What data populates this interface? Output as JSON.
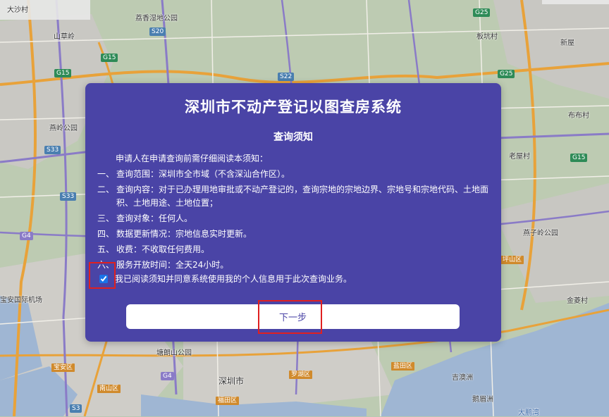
{
  "map": {
    "places": [
      {
        "id": "dashacun",
        "label": "大沙村"
      },
      {
        "id": "lizhuwetland",
        "label": "荔香湿地公园"
      },
      {
        "id": "shancaocun",
        "label": "山草岭"
      },
      {
        "id": "bantiancun",
        "label": "板坑村"
      },
      {
        "id": "xinwu",
        "label": "新屋"
      },
      {
        "id": "yanlingpark",
        "label": "燕岭公园"
      },
      {
        "id": "bubucun",
        "label": "布布村"
      },
      {
        "id": "laolaowu",
        "label": "老屋村"
      },
      {
        "id": "yanzilingpark",
        "label": "燕子岭公园"
      },
      {
        "id": "baoan_airport",
        "label": "宝安国际机场"
      },
      {
        "id": "jinlingcun",
        "label": "金菱村"
      },
      {
        "id": "tanglangshan",
        "label": "塘朗山公园"
      },
      {
        "id": "shenzhenshi",
        "label": "深圳市"
      },
      {
        "id": "jiyucun",
        "label": "吉澳洲"
      },
      {
        "id": "egezhou",
        "label": "鹅眉洲"
      },
      {
        "id": "dapengwan",
        "label": "大鹏湾"
      }
    ],
    "shields": [
      "G25",
      "G25",
      "S20",
      "G15",
      "G15",
      "S22",
      "G15",
      "S33",
      "S33",
      "G4",
      "G4",
      "S3"
    ],
    "districts": [
      "坪山区",
      "宝安区",
      "南山区",
      "福田区",
      "罗湖区",
      "盐田区"
    ]
  },
  "dialog": {
    "title": "深圳市不动产登记以图查房系统",
    "heading": "查询须知",
    "intro": "申请人在申请查询前需仔细阅读本须知：",
    "items": [
      {
        "num": "一、",
        "text": "查询范围：深圳市全市域（不含深汕合作区）。"
      },
      {
        "num": "二、",
        "text": "查询内容：对于已办理用地审批或不动产登记的，查询宗地的宗地边界、宗地号和宗地代码、土地面积、土地用途、土地位置；"
      },
      {
        "num": "三、",
        "text": "查询对象：任何人。"
      },
      {
        "num": "四、",
        "text": "数据更新情况：宗地信息实时更新。"
      },
      {
        "num": "五、",
        "text": "收费：不收取任何费用。"
      },
      {
        "num": "六、",
        "text": "服务开放时间：全天24小时。"
      }
    ],
    "agree_label": "我已阅读须知并同意系统使用我的个人信息用于此次查询业务。",
    "agree_checked": true,
    "next_label": "下一步"
  }
}
